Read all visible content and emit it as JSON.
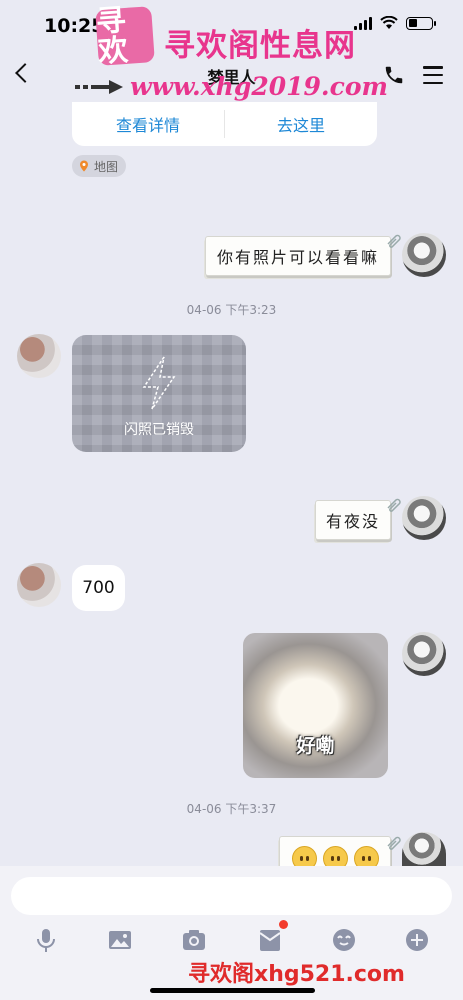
{
  "status_bar": {
    "time": "10:25"
  },
  "watermark": {
    "logo_text": "寻欢",
    "title": "寻欢阁性息网",
    "url": "www.xhg2019.com",
    "footer": "寻欢阁xhg521.com"
  },
  "nav": {
    "title": "梦里人"
  },
  "location_card": {
    "details_label": "查看详情",
    "go_label": "去这里",
    "map_tag": "地图"
  },
  "messages": {
    "m1": "你有照片可以看看嘛",
    "t1": "04-06 下午3:23",
    "flash": "闪照已销毁",
    "m2": "有夜没",
    "m3": "700",
    "cat_caption": "好嘞",
    "t2": "04-06 下午3:37"
  },
  "colors": {
    "accent": "#1e88d6",
    "watermark": "#e8358d",
    "background": "#e9eaf3"
  }
}
